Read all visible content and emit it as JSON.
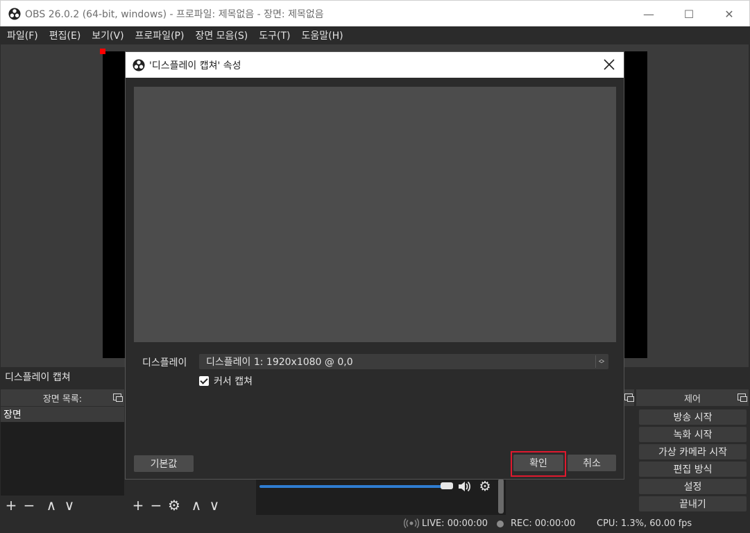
{
  "window": {
    "title": "OBS 26.0.2 (64-bit, windows) - 프로파일: 제목없음 - 장면: 제목없음",
    "minimize": "—",
    "maximize": "☐",
    "close": "✕"
  },
  "menu": [
    "파일(F)",
    "편집(E)",
    "보기(V)",
    "프로파일(P)",
    "장면 모음(S)",
    "도구(T)",
    "도움말(H)"
  ],
  "source_label": "디스플레이 캡쳐",
  "docks": {
    "scenes_title": "장면 목록:",
    "controls_title": "제어"
  },
  "scenes": [
    "장면"
  ],
  "controls": [
    "방송 시작",
    "녹화 시작",
    "가상 카메라 시작",
    "편집 방식",
    "설정",
    "끝내기"
  ],
  "toolbar_icons": {
    "add": "+",
    "remove": "−",
    "up": "∧",
    "down": "∨",
    "settings": "⚙"
  },
  "mixer_icons": {
    "speaker": "🔊",
    "gear": "⚙"
  },
  "mixer_volume": 1.0,
  "status": {
    "live": "LIVE: 00:00:00",
    "rec": "REC: 00:00:00",
    "cpu": "CPU: 1.3%, 60.00 fps"
  },
  "dialog": {
    "title": "'디스플레이 캡쳐' 속성",
    "display_label": "디스플레이",
    "display_value": "디스플레이 1: 1920x1080 @ 0,0",
    "cursor_label": "커서 캡쳐",
    "cursor_checked": true,
    "defaults_button": "기본값",
    "ok_button": "확인",
    "cancel_button": "취소"
  },
  "colors": {
    "accent_slider": "#2f7dd1",
    "highlight_outline": "#e0192e",
    "selection_handle": "#ff0000"
  }
}
